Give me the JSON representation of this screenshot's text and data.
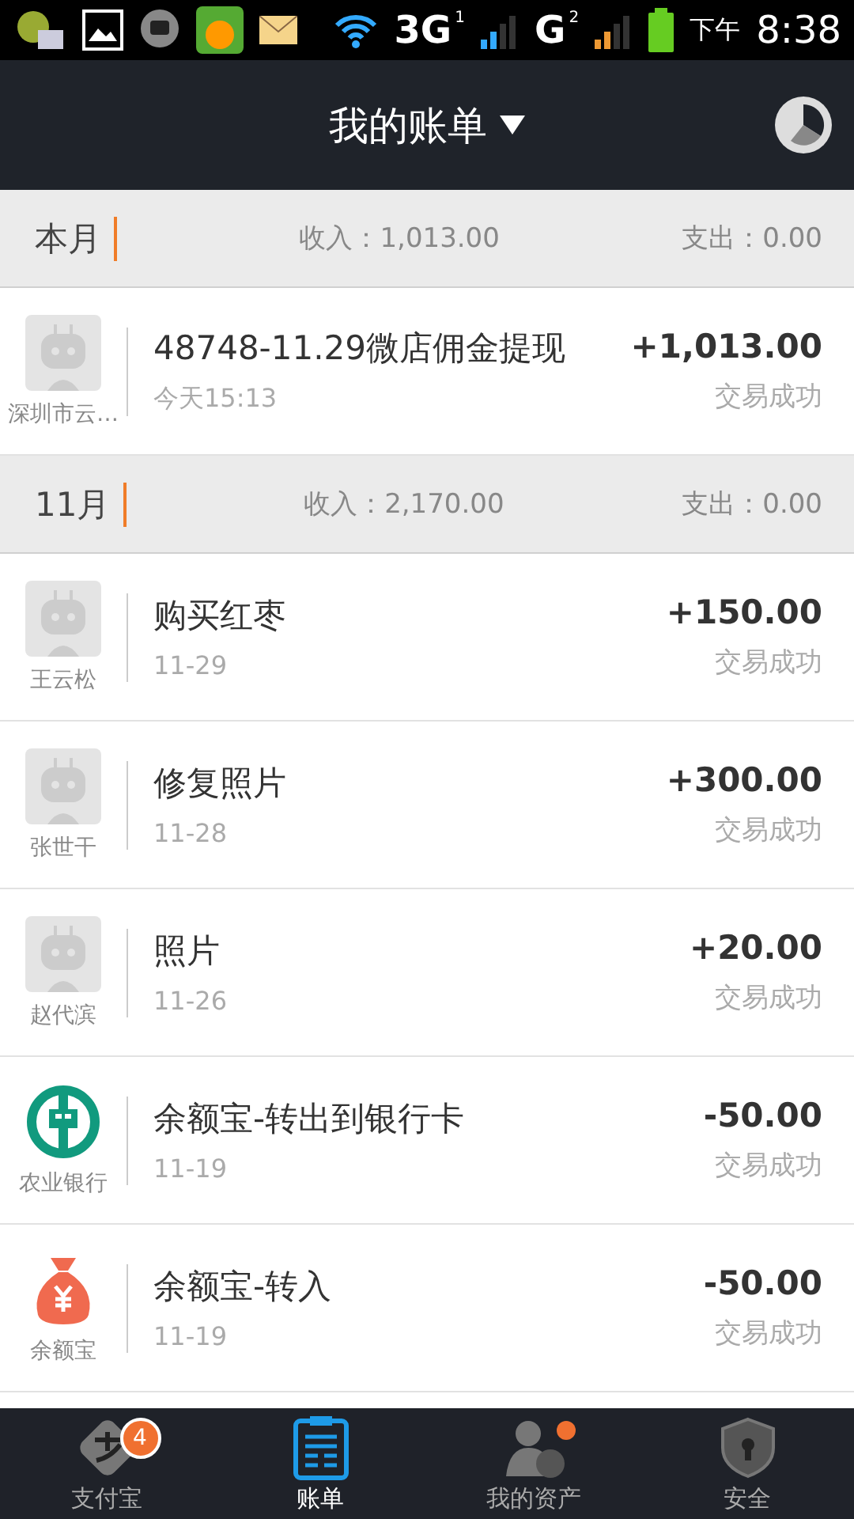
{
  "status_bar": {
    "network_1": "3G",
    "sim_1": "1",
    "network_2": "G",
    "sim_2": "2",
    "period": "下午",
    "time": "8:38"
  },
  "header": {
    "title": "我的账单"
  },
  "sections": [
    {
      "month": "本月",
      "income": "收入：1,013.00",
      "expense": "支出：0.00",
      "rows": [
        {
          "kind": "robot",
          "payer": "深圳市云…",
          "title": "48748-11.29微店佣金提现",
          "date": "今天15:13",
          "amount": "+1,013.00",
          "status": "交易成功"
        }
      ]
    },
    {
      "month": "11月",
      "income": "收入：2,170.00",
      "expense": "支出：0.00",
      "rows": [
        {
          "kind": "robot",
          "payer": "王云松",
          "title": "购买红枣",
          "date": "11-29",
          "amount": "+150.00",
          "status": "交易成功"
        },
        {
          "kind": "robot",
          "payer": "张世干",
          "title": "修复照片",
          "date": "11-28",
          "amount": "+300.00",
          "status": "交易成功"
        },
        {
          "kind": "robot",
          "payer": "赵代滨",
          "title": "照片",
          "date": "11-26",
          "amount": "+20.00",
          "status": "交易成功"
        },
        {
          "kind": "bank",
          "payer": "农业银行",
          "title": "余额宝-转出到银行卡",
          "date": "11-19",
          "amount": "-50.00",
          "status": "交易成功"
        },
        {
          "kind": "moneybag",
          "payer": "余额宝",
          "title": "余额宝-转入",
          "date": "11-19",
          "amount": "-50.00",
          "status": "交易成功"
        }
      ]
    }
  ],
  "tabs": [
    {
      "kind": "wallet",
      "label": "支付宝",
      "selected": false,
      "badge": "4",
      "dot": false
    },
    {
      "kind": "bill",
      "label": "账单",
      "selected": true,
      "dot": false
    },
    {
      "kind": "assets",
      "label": "我的资产",
      "selected": false,
      "dot": true
    },
    {
      "kind": "security",
      "label": "安全",
      "selected": false,
      "dot": false
    }
  ]
}
